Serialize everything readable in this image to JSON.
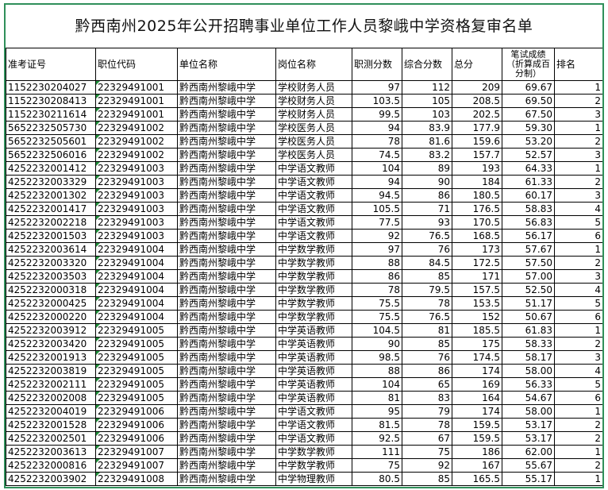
{
  "title": "黔西南州2025年公开招聘事业单位工作人员黎峨中学资格复审名单",
  "columns": [
    "准考证号",
    "职位代码",
    "单位名称",
    "岗位名称",
    "职测分数",
    "综合分数",
    "总分",
    "笔试成绩（折算成百分制）",
    "排名"
  ],
  "rows": [
    [
      "1152230204027",
      "22329491001",
      "黔西南州黎峨中学",
      "学校财务人员",
      "97",
      "112",
      "209",
      "69.67",
      "1"
    ],
    [
      "1152230208413",
      "22329491001",
      "黔西南州黎峨中学",
      "学校财务人员",
      "103.5",
      "105",
      "208.5",
      "69.50",
      "2"
    ],
    [
      "1152230211614",
      "22329491001",
      "黔西南州黎峨中学",
      "学校财务人员",
      "99.5",
      "103",
      "202.5",
      "67.50",
      "3"
    ],
    [
      "5652232505730",
      "22329491002",
      "黔西南州黎峨中学",
      "学校医务人员",
      "94",
      "83.9",
      "177.9",
      "59.30",
      "1"
    ],
    [
      "5652232505601",
      "22329491002",
      "黔西南州黎峨中学",
      "学校医务人员",
      "78",
      "81.6",
      "159.6",
      "53.20",
      "2"
    ],
    [
      "5652232506016",
      "22329491002",
      "黔西南州黎峨中学",
      "学校医务人员",
      "74.5",
      "83.2",
      "157.7",
      "52.57",
      "3"
    ],
    [
      "4252232001412",
      "22329491003",
      "黔西南州黎峨中学",
      "中学语文教师",
      "104",
      "89",
      "193",
      "64.33",
      "1"
    ],
    [
      "4252232003329",
      "22329491003",
      "黔西南州黎峨中学",
      "中学语文教师",
      "94",
      "90",
      "184",
      "61.33",
      "2"
    ],
    [
      "4252232001302",
      "22329491003",
      "黔西南州黎峨中学",
      "中学语文教师",
      "94.5",
      "86",
      "180.5",
      "60.17",
      "3"
    ],
    [
      "4252232001417",
      "22329491003",
      "黔西南州黎峨中学",
      "中学语文教师",
      "105.5",
      "71",
      "176.5",
      "58.83",
      "4"
    ],
    [
      "4252232002218",
      "22329491003",
      "黔西南州黎峨中学",
      "中学语文教师",
      "77.5",
      "93",
      "170.5",
      "56.83",
      "5"
    ],
    [
      "4252232001503",
      "22329491003",
      "黔西南州黎峨中学",
      "中学语文教师",
      "92",
      "76.5",
      "168.5",
      "56.17",
      "6"
    ],
    [
      "4252232003614",
      "22329491004",
      "黔西南州黎峨中学",
      "中学数学教师",
      "97",
      "76",
      "173",
      "57.67",
      "1"
    ],
    [
      "4252232003320",
      "22329491004",
      "黔西南州黎峨中学",
      "中学数学教师",
      "88",
      "84.5",
      "172.5",
      "57.50",
      "2"
    ],
    [
      "4252232003503",
      "22329491004",
      "黔西南州黎峨中学",
      "中学数学教师",
      "86",
      "85",
      "171",
      "57.00",
      "3"
    ],
    [
      "4252232000318",
      "22329491004",
      "黔西南州黎峨中学",
      "中学数学教师",
      "78",
      "79.5",
      "157.5",
      "52.50",
      "4"
    ],
    [
      "4252232000425",
      "22329491004",
      "黔西南州黎峨中学",
      "中学数学教师",
      "75.5",
      "78",
      "153.5",
      "51.17",
      "5"
    ],
    [
      "4252232000220",
      "22329491004",
      "黔西南州黎峨中学",
      "中学数学教师",
      "75.5",
      "76.5",
      "152",
      "50.67",
      "6"
    ],
    [
      "4252232003912",
      "22329491005",
      "黔西南州黎峨中学",
      "中学英语教师",
      "104.5",
      "81",
      "185.5",
      "61.83",
      "1"
    ],
    [
      "4252232003420",
      "22329491005",
      "黔西南州黎峨中学",
      "中学英语教师",
      "90",
      "85",
      "175",
      "58.33",
      "2"
    ],
    [
      "4252232001913",
      "22329491005",
      "黔西南州黎峨中学",
      "中学英语教师",
      "98.5",
      "76",
      "174.5",
      "58.17",
      "3"
    ],
    [
      "4252232003819",
      "22329491005",
      "黔西南州黎峨中学",
      "中学英语教师",
      "88",
      "86",
      "174",
      "58.00",
      "4"
    ],
    [
      "4252232002111",
      "22329491005",
      "黔西南州黎峨中学",
      "中学英语教师",
      "104",
      "65",
      "169",
      "56.33",
      "5"
    ],
    [
      "4252232002008",
      "22329491005",
      "黔西南州黎峨中学",
      "中学英语教师",
      "81",
      "83",
      "164",
      "54.67",
      "6"
    ],
    [
      "4252232004019",
      "22329491006",
      "黔西南州黎峨中学",
      "中学语文教师",
      "95",
      "79",
      "174",
      "58.00",
      "1"
    ],
    [
      "4252232001528",
      "22329491006",
      "黔西南州黎峨中学",
      "中学语文教师",
      "81.5",
      "78",
      "159.5",
      "53.17",
      "2"
    ],
    [
      "4252232002501",
      "22329491006",
      "黔西南州黎峨中学",
      "中学语文教师",
      "92.5",
      "67",
      "159.5",
      "53.17",
      "2"
    ],
    [
      "4252232003613",
      "22329491007",
      "黔西南州黎峨中学",
      "中学数学教师",
      "111",
      "75",
      "186",
      "62.00",
      "1"
    ],
    [
      "4252232000816",
      "22329491007",
      "黔西南州黎峨中学",
      "中学数学教师",
      "75",
      "92",
      "167",
      "55.67",
      "2"
    ],
    [
      "4252232003902",
      "22329491008",
      "黔西南州黎峨中学",
      "中学物理教师",
      "80.5",
      "85",
      "165.5",
      "55.17",
      "1"
    ]
  ]
}
